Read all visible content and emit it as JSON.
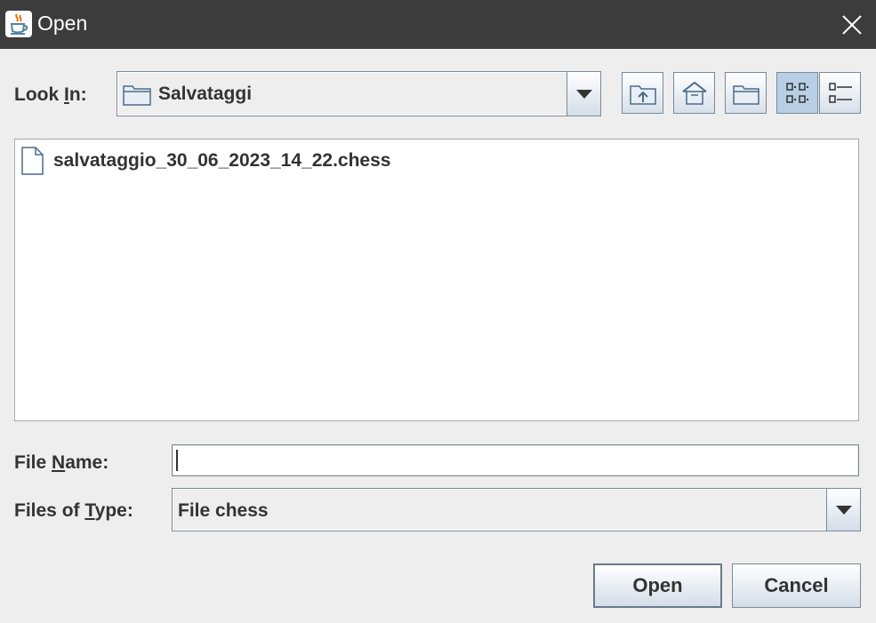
{
  "window": {
    "title": "Open",
    "app_icon": "java-cup-icon"
  },
  "look_in": {
    "label_pre": "Look ",
    "label_mnemonic": "I",
    "label_post": "n:",
    "value": "Salvataggi",
    "icon": "folder-icon"
  },
  "toolbar": [
    {
      "name": "up-one-level-button",
      "icon": "up-folder-icon"
    },
    {
      "name": "home-button",
      "icon": "home-icon"
    },
    {
      "name": "create-new-folder-button",
      "icon": "new-folder-icon"
    },
    {
      "name": "list-view-button",
      "icon": "list-view-icon",
      "selected": true
    },
    {
      "name": "details-view-button",
      "icon": "details-view-icon",
      "selected": false
    }
  ],
  "files": [
    {
      "name": "salvataggio_30_06_2023_14_22.chess",
      "icon": "file-icon"
    }
  ],
  "file_name": {
    "label_pre": "File ",
    "label_mnemonic": "N",
    "label_post": "ame:",
    "value": ""
  },
  "file_type": {
    "label_pre": "Files of ",
    "label_mnemonic": "T",
    "label_post": "ype:",
    "value": "File chess"
  },
  "buttons": {
    "open": "Open",
    "cancel": "Cancel"
  }
}
